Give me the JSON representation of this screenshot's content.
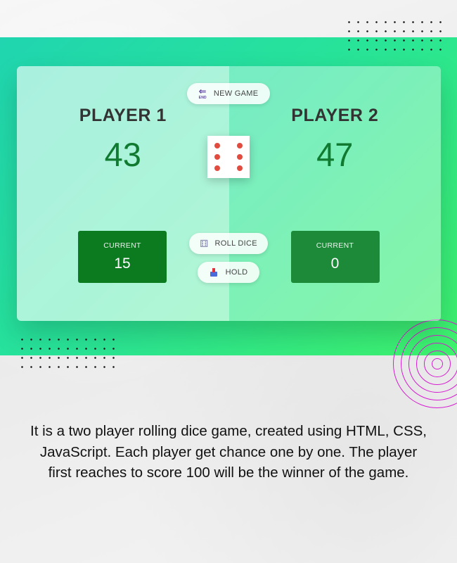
{
  "game": {
    "new_game_label": "NEW GAME",
    "new_game_icon": "end-arrow-icon",
    "roll_dice_label": "ROLL DICE",
    "roll_dice_icon": "dice-icon",
    "hold_label": "HOLD",
    "hold_icon": "inbox-tray-icon",
    "dice_value": 6
  },
  "players": [
    {
      "name": "PLAYER 1",
      "score": "43",
      "current_label": "CURRENT",
      "current_score": "15",
      "active": true
    },
    {
      "name": "PLAYER 2",
      "score": "47",
      "current_label": "CURRENT",
      "current_score": "0",
      "active": false
    }
  ],
  "description": "It is a two player rolling dice game, created using HTML, CSS, JavaScript. Each player get chance one by one. The player first reaches to score 100 will be the winner of the game.",
  "colors": {
    "score_green": "#0f7a30",
    "current_active": "#0c7a1f",
    "current_inactive": "#1c8a38",
    "dice_pip": "#e24b3f",
    "ring_magenta": "#d51ed1",
    "banner_start": "#20d5b0",
    "banner_end": "#3ef26c"
  }
}
